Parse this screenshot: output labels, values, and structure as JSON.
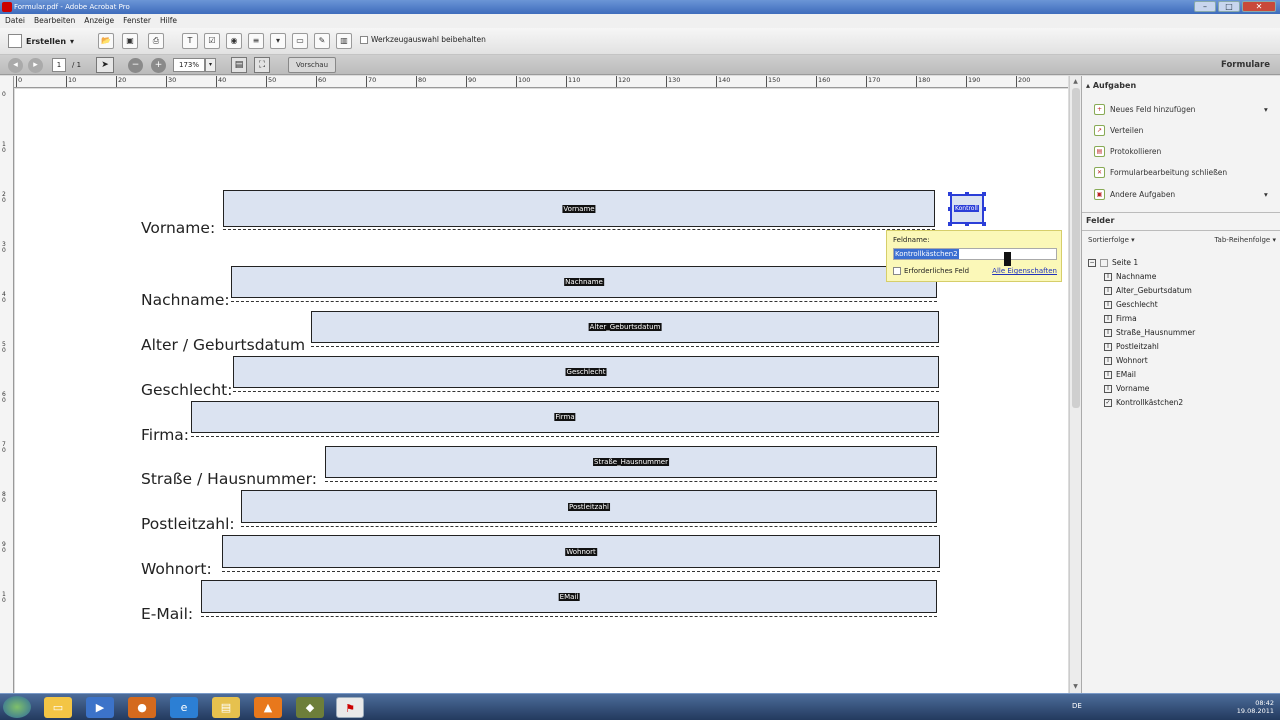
{
  "window": {
    "title": "Formular.pdf - Adobe Acrobat Pro",
    "buttons": [
      "–",
      "□",
      "✕"
    ]
  },
  "menu": [
    "Datei",
    "Bearbeiten",
    "Anzeige",
    "Fenster",
    "Hilfe"
  ],
  "toolbar": {
    "create_label": "Erstellen",
    "keep_tool_label": "Werkzeugauswahl beibehalten"
  },
  "nav": {
    "page_current": "1",
    "page_total": "/ 1",
    "zoom": "173%",
    "preview_label": "Vorschau",
    "mode_label": "Formulare"
  },
  "ruler": {
    "top": [
      "0",
      "10",
      "20",
      "30",
      "40",
      "50",
      "60",
      "70",
      "80",
      "90",
      "100",
      "110",
      "120",
      "130",
      "140",
      "150",
      "160",
      "170",
      "180",
      "190",
      "200"
    ],
    "left": [
      "0",
      "1 0",
      "2 0",
      "3 0",
      "4 0",
      "5 0",
      "6 0",
      "7 0",
      "8 0",
      "9 0",
      "1 0"
    ]
  },
  "form": {
    "labels": [
      "Vorname:",
      "Nachname:",
      "Alter / Geburtsdatum",
      "Geschlecht:",
      "Firma:",
      "Straße / Hausnummer:",
      "Postleitzahl:",
      "Wohnort:",
      "E-Mail:"
    ],
    "fields": [
      "Vorname",
      "Nachname",
      "Alter_Geburtsdatum",
      "Geschlecht",
      "Firma",
      "Straße_Hausnummer",
      "Postleitzahl",
      "Wohnort",
      "EMail"
    ],
    "checkbox_label": "Kontroll"
  },
  "popup": {
    "field_name_label": "Feldname:",
    "field_name_value": "Kontrollkästchen2",
    "required_label": "Erforderliches Feld",
    "all_properties_label": "Alle Eigenschaften"
  },
  "panel": {
    "tasks_title": "Aufgaben",
    "tasks": [
      "Neues Feld hinzufügen",
      "Verteilen",
      "Protokollieren",
      "Formularbearbeitung schließen",
      "Andere Aufgaben"
    ],
    "fields_title": "Felder",
    "sort_label": "Sortierfolge",
    "tab_order_label": "Tab-Reihenfolge",
    "page_node": "Seite 1",
    "tree": [
      "Nachname",
      "Alter_Geburtsdatum",
      "Geschlecht",
      "Firma",
      "Straße_Hausnummer",
      "Postleitzahl",
      "Wohnort",
      "EMail",
      "Vorname",
      "Kontrollkästchen2"
    ]
  },
  "taskbar": {
    "lang": "DE",
    "time": "08:42",
    "date": "19.08.2011"
  }
}
